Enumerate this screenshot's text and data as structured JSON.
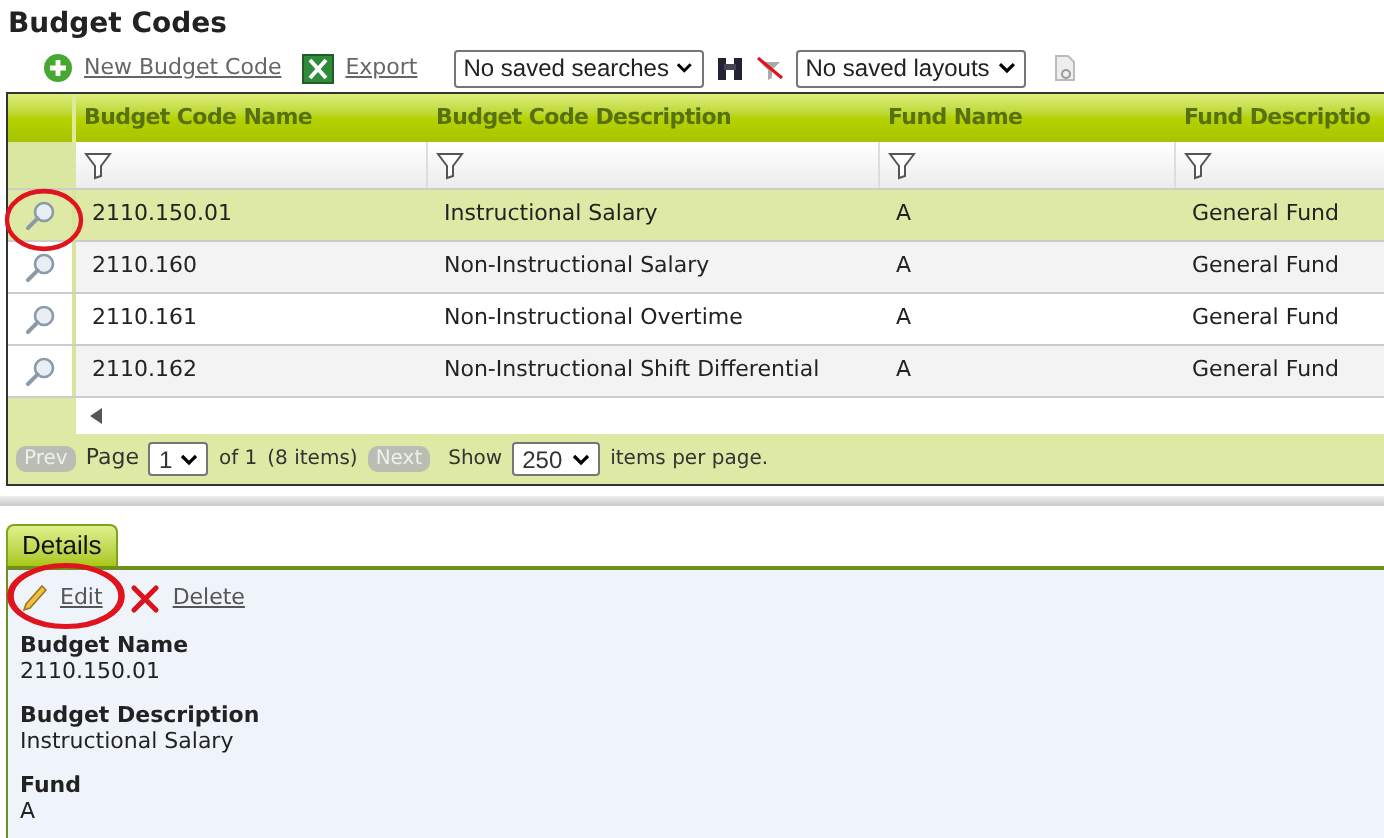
{
  "title": "Budget Codes",
  "toolbar": {
    "new_link": "New Budget Code",
    "export_link": "Export",
    "saved_searches": "No saved searches",
    "saved_layouts": "No saved layouts"
  },
  "table": {
    "columns": [
      "Budget Code Name",
      "Budget Code Description",
      "Fund Name",
      "Fund Descriptio"
    ],
    "rows": [
      {
        "cells": [
          "2110.150.01",
          "Instructional Salary",
          "A",
          "General Fund"
        ],
        "selected": true
      },
      {
        "cells": [
          "2110.160",
          "Non-Instructional Salary",
          "A",
          "General Fund"
        ],
        "selected": false
      },
      {
        "cells": [
          "2110.161",
          "Non-Instructional Overtime",
          "A",
          "General Fund"
        ],
        "selected": false
      },
      {
        "cells": [
          "2110.162",
          "Non-Instructional Shift Differential",
          "A",
          "General Fund"
        ],
        "selected": false
      }
    ]
  },
  "pager": {
    "prev": {
      "label": "Prev",
      "disabled": true
    },
    "page_label": "Page",
    "page": "1",
    "of_text": "of 1",
    "items_text": "(8 items)",
    "next": {
      "label": "Next",
      "disabled": true
    },
    "show_label": "Show",
    "per_page": "250",
    "per_page_label": "items per page."
  },
  "details": {
    "tab": "Details",
    "edit": "Edit",
    "delete": "Delete",
    "fields": [
      {
        "label": "Budget Name",
        "value": "2110.150.01"
      },
      {
        "label": "Budget Description",
        "value": "Instructional Salary"
      },
      {
        "label": "Fund",
        "value": "A"
      }
    ]
  }
}
